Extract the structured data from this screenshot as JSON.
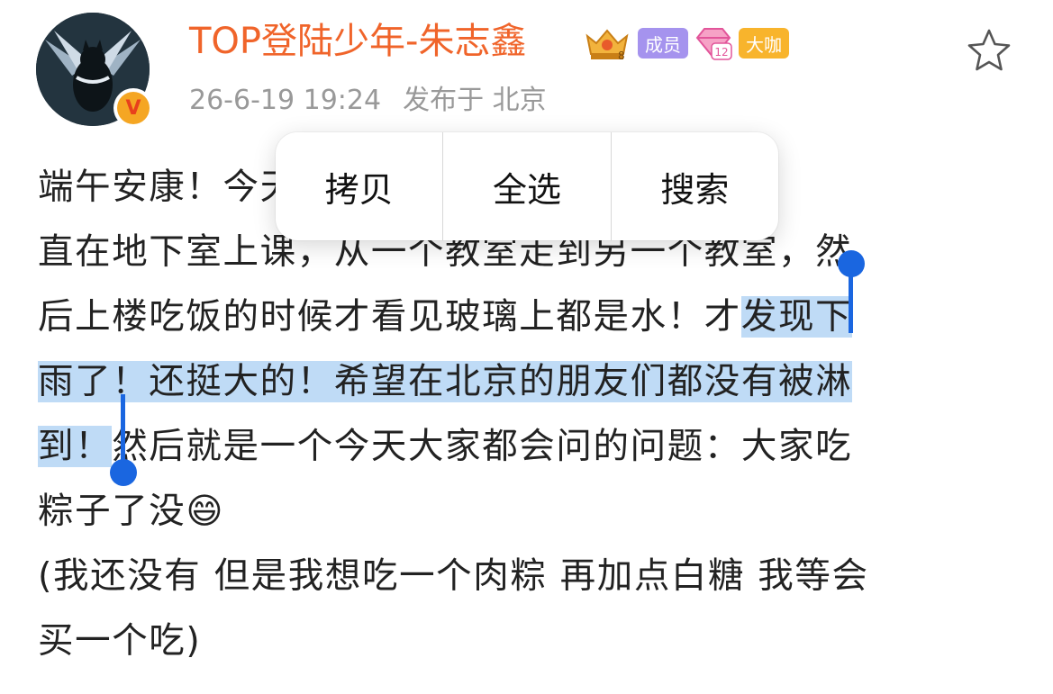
{
  "header": {
    "username": "TOP登陆少年-朱志鑫",
    "badges": {
      "crown_level": "8",
      "member_label": "成员",
      "gem_level": "12",
      "daka_label": "大咖"
    },
    "timestamp": "26-6-19 19:24",
    "location": "发布于 北京",
    "avatar_icon": "avatar-image",
    "verified_icon": "verified-v-icon",
    "favorite_icon": "star-outline-icon"
  },
  "colors": {
    "username": "#f0642a",
    "selection": "#bfdbf6",
    "handle": "#1a66e0",
    "member_badge": "#a593ee",
    "daka_badge": "#f8b42c",
    "meta": "#999999"
  },
  "post": {
    "line1": "端午安康！今天听说北京下雨了！但是我一",
    "line2": "直在地下室上课，从一个教室走到另一个教室，然",
    "line3_before": "后上楼吃饭的时候才看见玻璃上都是水！才",
    "line3_selected": "发现下",
    "line4_selected": "雨了！还挺大的！希望在北京的朋友们都没有被淋",
    "line5_selected": "到！",
    "line5_after": "然后就是一个今天大家都会问的问题：大家吃",
    "line6": "粽子了没",
    "line6_emoji": "😄",
    "line7": "(我还没有 但是我想吃一个肉粽 再加点白糖 我等会",
    "line8": "买一个吃)"
  },
  "context_menu": {
    "items": [
      {
        "label": "拷贝"
      },
      {
        "label": "全选"
      },
      {
        "label": "搜索"
      }
    ]
  }
}
